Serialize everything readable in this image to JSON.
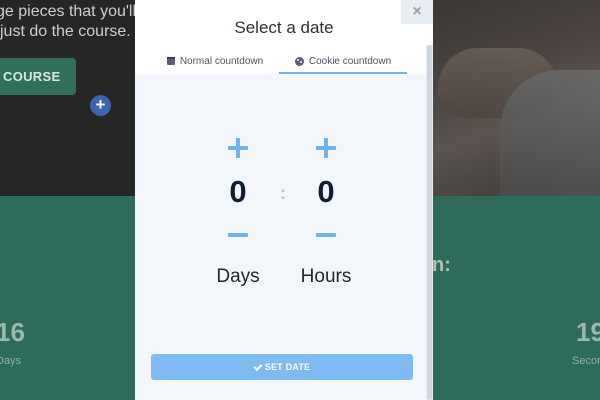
{
  "background": {
    "hero_text": "ge pieces that you'll m\njust do the course.",
    "hero_line1": "ge pieces that you'll m",
    "hero_line2": "just do the course.",
    "course_button_label": "COURSE",
    "plus_icon_glyph": "+",
    "teal_colon_text": "n:",
    "left_number": "16",
    "left_unit": "Days",
    "right_number": "19",
    "right_unit": "Secon"
  },
  "modal": {
    "title": "Select a date",
    "close_glyph": "×",
    "tabs": [
      {
        "label": "Normal countdown",
        "icon": "calendar-icon",
        "active": false
      },
      {
        "label": "Cookie countdown",
        "icon": "cookie-icon",
        "active": true
      }
    ],
    "counters": {
      "days": {
        "value": "0",
        "unit": "Days"
      },
      "separator": ":",
      "hours": {
        "value": "0",
        "unit": "Hours"
      }
    },
    "submit_label": "SET DATE"
  },
  "colors": {
    "accent": "#6fb3ee",
    "button": "#7dbbf0",
    "teal": "#2f6b5b",
    "modal_bg": "#f3f7fb"
  }
}
